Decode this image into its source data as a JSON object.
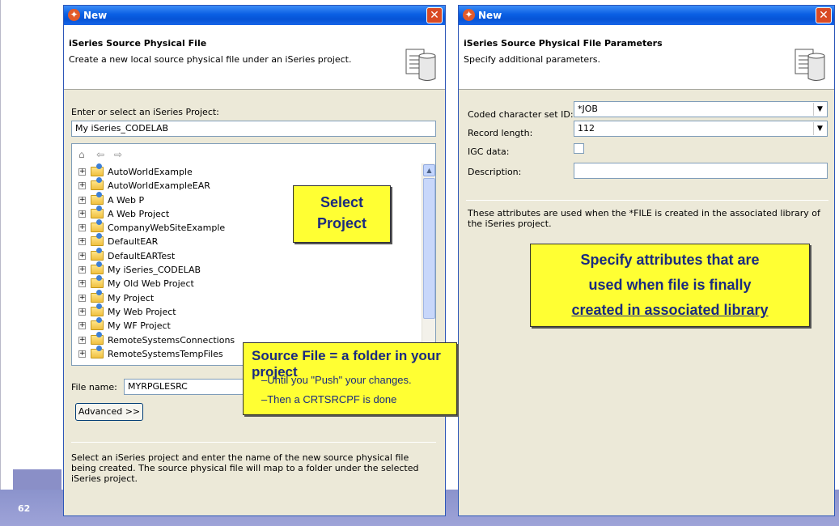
{
  "slide": {
    "page_number": "62"
  },
  "left_dialog": {
    "title": "New",
    "header_title": "iSeries Source Physical File",
    "header_desc": "Create a new local source physical file under an iSeries project.",
    "project_label": "Enter or select an iSeries Project:",
    "project_value": "My iSeries_CODELAB",
    "projects": [
      "AutoWorldExample",
      "AutoWorldExampleEAR",
      "A Web P",
      "A Web Project",
      "CompanyWebSiteExample",
      "DefaultEAR",
      "DefaultEARTest",
      "My iSeries_CODELAB",
      "My Old Web Project",
      "My Project",
      "My Web Project",
      "My WF Project",
      "RemoteSystemsConnections",
      "RemoteSystemsTempFiles"
    ],
    "file_name_label": "File name:",
    "file_name_value": "MYRPGLESRC",
    "advanced_button": "Advanced >>",
    "help_text": "Select an iSeries project and enter the name of the new source physical file being created. The source physical file will map to a folder under the selected iSeries project."
  },
  "right_dialog": {
    "title": "New",
    "header_title": "iSeries Source Physical File Parameters",
    "header_desc": "Specify additional parameters.",
    "ccsid_label": "Coded character set ID:",
    "ccsid_value": "*JOB",
    "record_length_label": "Record length:",
    "record_length_value": "112",
    "igc_label": "IGC data:",
    "description_label": "Description:",
    "info_text": "These attributes are used when the *FILE is created in the associated library of the iSeries project."
  },
  "callouts": {
    "select_project_1": "Select",
    "select_project_2": "Project",
    "attrs_1": "Specify attributes that are",
    "attrs_2": "used when file is finally",
    "attrs_3": "created in associated library",
    "source_title": "Source File = a folder in your project",
    "source_line1": "–Until you \"Push\" your changes.",
    "source_line2": "–Then a CRTSRCPF is done"
  }
}
